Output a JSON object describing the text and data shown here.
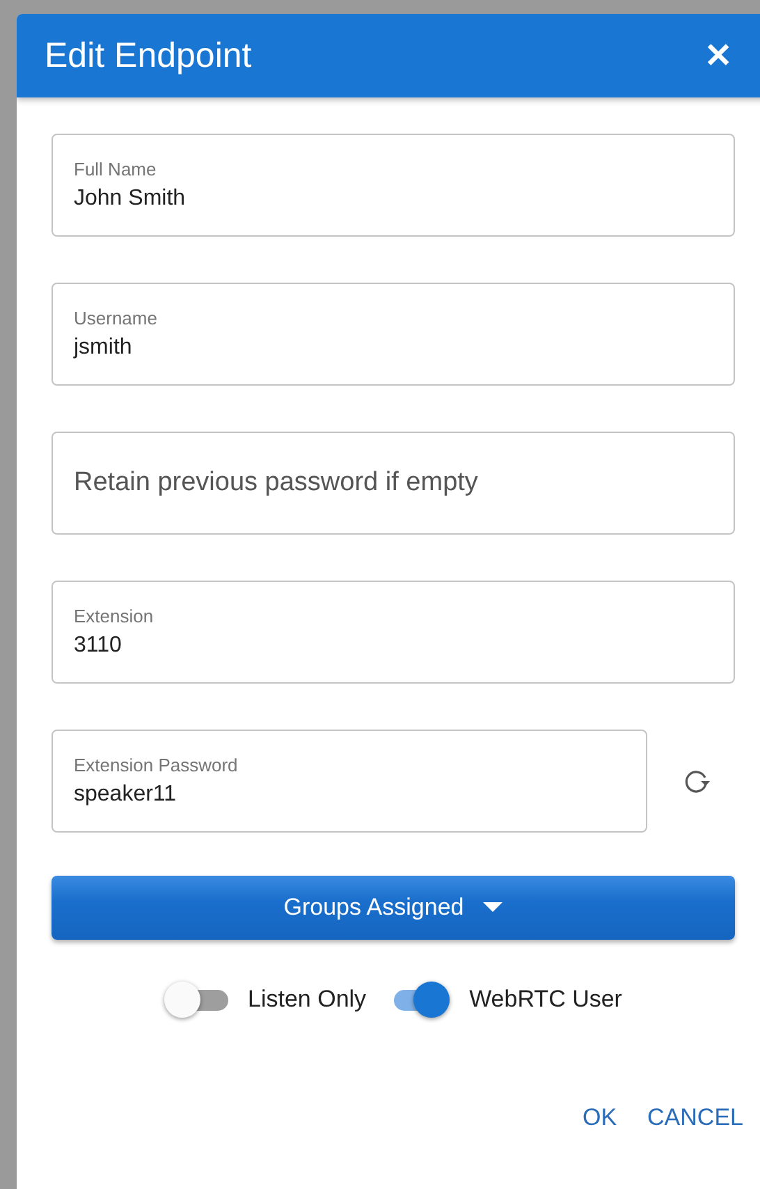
{
  "dialog": {
    "title": "Edit Endpoint",
    "close": "✕"
  },
  "fields": [
    {
      "label": "Full Name",
      "value": "John Smith"
    },
    {
      "label": "Username",
      "value": "jsmith"
    },
    {
      "placeholder": "Retain previous password if empty"
    },
    {
      "label": "Extension",
      "value": "3110"
    },
    {
      "label": "Extension Password",
      "value": "speaker11",
      "refresh": true
    }
  ],
  "groups_button": {
    "label": "Groups Assigned"
  },
  "toggles": [
    {
      "label": "Listen Only",
      "on": false
    },
    {
      "label": "WebRTC User",
      "on": true
    }
  ],
  "actions": [
    "OK",
    "CANCEL"
  ]
}
